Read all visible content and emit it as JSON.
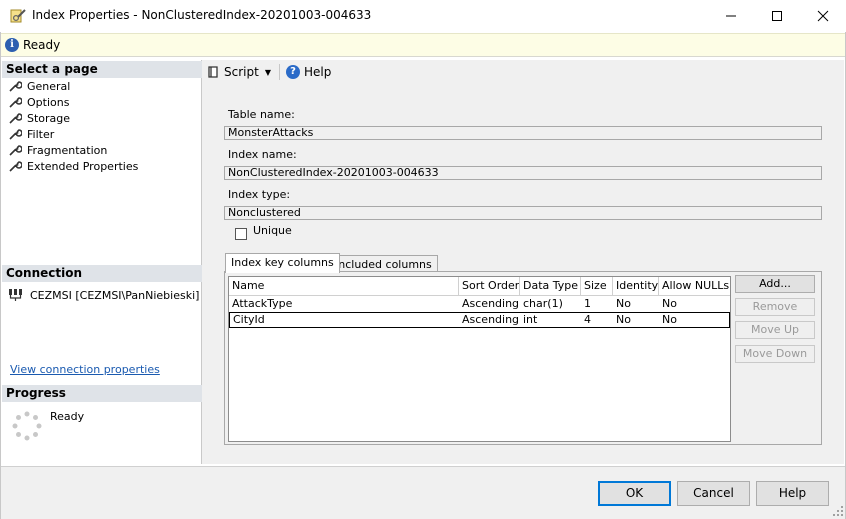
{
  "window": {
    "title": "Index Properties - NonClusteredIndex-20201003-004633"
  },
  "status": {
    "text": "Ready"
  },
  "left": {
    "select_heading": "Select a page",
    "pages": [
      {
        "label": "General"
      },
      {
        "label": "Options"
      },
      {
        "label": "Storage"
      },
      {
        "label": "Filter"
      },
      {
        "label": "Fragmentation"
      },
      {
        "label": "Extended Properties"
      }
    ],
    "connection_heading": "Connection",
    "connection_text": "CEZMSI [CEZMSI\\PanNiebieski]",
    "view_link": "View connection properties",
    "progress_heading": "Progress",
    "progress_text": "Ready"
  },
  "toolbar": {
    "script_label": "Script",
    "help_label": "Help"
  },
  "form": {
    "table_name_label": "Table name:",
    "table_name_value": "MonsterAttacks",
    "index_name_label": "Index name:",
    "index_name_value": "NonClusteredIndex-20201003-004633",
    "index_type_label": "Index type:",
    "index_type_value": "Nonclustered",
    "unique_label": "Unique",
    "unique_checked": false
  },
  "tabs": [
    {
      "label": "Index key columns",
      "active": true
    },
    {
      "label": "Included columns",
      "active": false
    }
  ],
  "grid": {
    "columns": [
      "Name",
      "Sort Order",
      "Data Type",
      "Size",
      "Identity",
      "Allow NULLs"
    ],
    "rows": [
      [
        "AttackType",
        "Ascending",
        "char(1)",
        "1",
        "No",
        "No"
      ],
      [
        "CityId",
        "Ascending",
        "int",
        "4",
        "No",
        "No"
      ]
    ]
  },
  "side_buttons": {
    "add": "Add...",
    "remove": "Remove",
    "move_up": "Move Up",
    "move_down": "Move Down"
  },
  "dialog_buttons": {
    "ok": "OK",
    "cancel": "Cancel",
    "help": "Help"
  },
  "colors": {
    "accent": "#0078d7",
    "status_bg": "#fdfde5",
    "section_bg": "#dfe3e8",
    "link": "#1a5ab0"
  }
}
